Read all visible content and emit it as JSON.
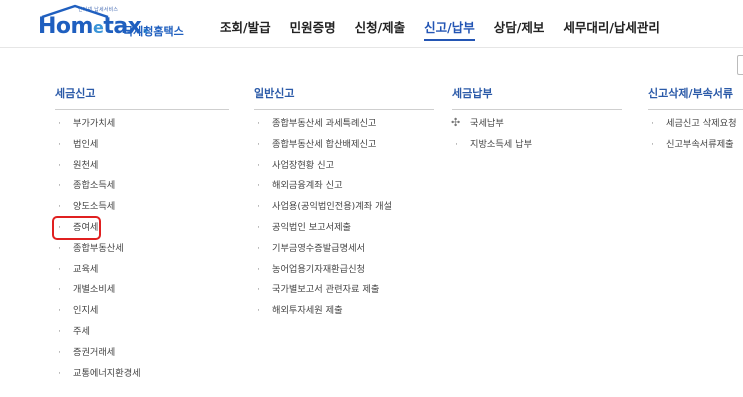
{
  "header": {
    "logo_tagline": "인터넷 납세서비스",
    "logo_brand_a": "Hom",
    "logo_brand_e": "e",
    "logo_brand_b": "tax",
    "logo_brand_dot": ".",
    "logo_subname": "국세청홈택스",
    "nav": [
      {
        "label": "조회/발급",
        "active": false
      },
      {
        "label": "민원증명",
        "active": false
      },
      {
        "label": "신청/제출",
        "active": false
      },
      {
        "label": "신고/납부",
        "active": true
      },
      {
        "label": "상담/제보",
        "active": false
      },
      {
        "label": "세무대리/납세관리",
        "active": false
      }
    ]
  },
  "columns": [
    {
      "title": "세금신고",
      "items": [
        "부가가치세",
        "법인세",
        "원천세",
        "종합소득세",
        "양도소득세",
        "증여세",
        "종합부동산세",
        "교육세",
        "개별소비세",
        "인지세",
        "주세",
        "증권거래세",
        "교통에너지환경세"
      ]
    },
    {
      "title": "일반신고",
      "items": [
        "종합부동산세 과세특례신고",
        "종합부동산세 합산배제신고",
        "사업장현황 신고",
        "해외금융계좌 신고",
        "사업용(공익법인전용)계좌 개설",
        "공익법인 보고서제출",
        "기부금영수증발급명세서",
        "농어업용기자재환급신청",
        "국가별보고서 관련자료 제출",
        "해외투자세원 제출"
      ]
    },
    {
      "title": "세금납부",
      "items": [
        "국세납부",
        "지방소득세 납부"
      ]
    },
    {
      "title": "신고삭제/부속서류",
      "items": [
        "세금신고 삭제요청",
        "신고부속서류제출"
      ]
    }
  ],
  "highlighted_item": "증여세",
  "colors": {
    "brand": "#1f5fbf",
    "active_nav": "#2355b4",
    "column_title": "#2b5aa8",
    "highlight_box": "#e02020"
  }
}
